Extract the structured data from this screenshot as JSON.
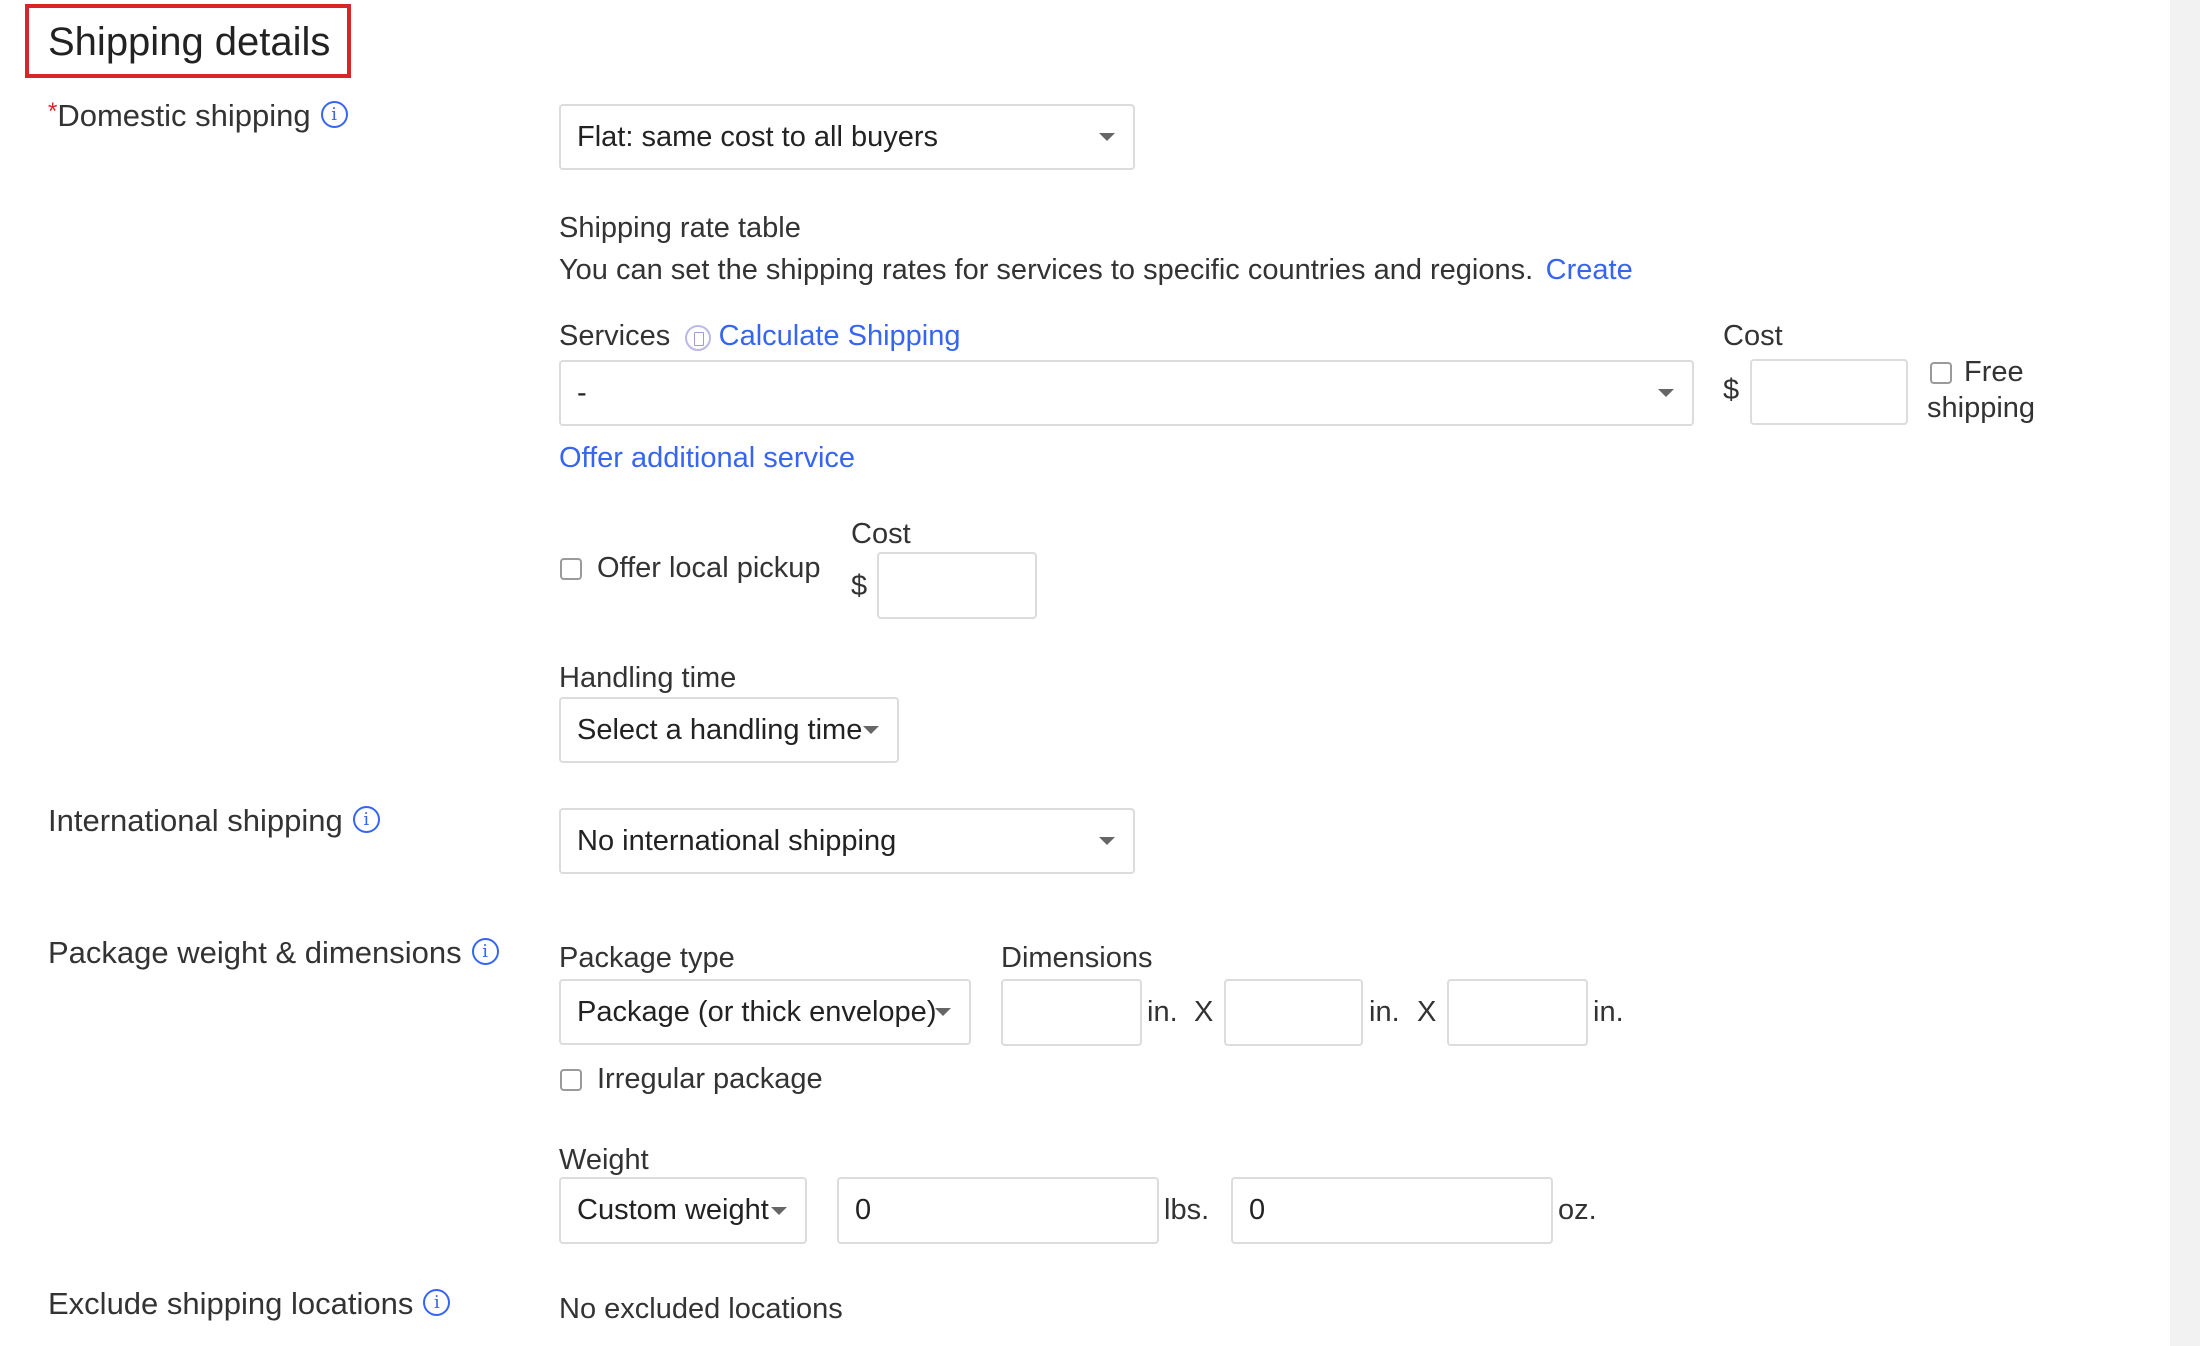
{
  "section": {
    "title": "Shipping details"
  },
  "domestic": {
    "required_mark": "*",
    "label": "Domestic shipping",
    "type_select": "Flat: same cost to all buyers",
    "rate_table_heading": "Shipping rate table",
    "rate_table_desc": "You can set the shipping rates for services to specific countries and regions.",
    "rate_table_link": "Create",
    "services_label": "Services",
    "calc_link": "Calculate Shipping",
    "service_select": "-",
    "cost_label": "Cost",
    "currency": "$",
    "cost_value": "",
    "free_shipping_line1": "Free",
    "free_shipping_line2": "shipping",
    "offer_additional": "Offer additional service",
    "local_pickup_label": "Offer local pickup",
    "pickup_cost_label": "Cost",
    "pickup_currency": "$",
    "pickup_cost_value": "",
    "handling_label": "Handling time",
    "handling_select": "Select a handling time"
  },
  "international": {
    "label": "International shipping",
    "select": "No international shipping"
  },
  "package": {
    "label": "Package weight & dimensions",
    "type_label": "Package type",
    "type_select": "Package (or thick envelope)",
    "dimensions_label": "Dimensions",
    "dim_unit": "in.",
    "dim_sep": "X",
    "dims": [
      "",
      "",
      ""
    ],
    "irregular_label": "Irregular package",
    "weight_label": "Weight",
    "weight_select": "Custom weight",
    "lbs_value": "0",
    "lbs_unit": "lbs.",
    "oz_value": "0",
    "oz_unit": "oz."
  },
  "exclude": {
    "label": "Exclude shipping locations",
    "value": "No excluded locations"
  },
  "colors": {
    "accent_link": "#3665f3",
    "required_red": "#d9252a",
    "border": "#dcdcdc"
  }
}
